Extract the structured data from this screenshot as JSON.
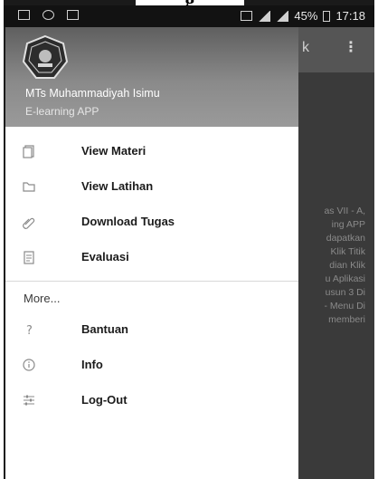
{
  "top_cut_text": "g",
  "status_bar": {
    "battery": "45%",
    "time": "17:18"
  },
  "background_app": {
    "title_fragment": "k",
    "overflow_icon": "more-vertical-icon",
    "text_lines": [
      "as VII - A,",
      "ing APP",
      "dapatkan",
      "Klik Titik",
      "dian Klik",
      "u Aplikasi",
      "usun 3 Di",
      "- Menu Di",
      "memberi"
    ]
  },
  "drawer": {
    "logo_icon": "school-emblem-icon",
    "school_name": "MTs Muhammadiyah Isimu",
    "app_subtitle": "E-learning APP",
    "items": [
      {
        "label": "View Materi",
        "icon": "documents-icon"
      },
      {
        "label": "View Latihan",
        "icon": "folder-icon"
      },
      {
        "label": "Download Tugas",
        "icon": "attachment-icon"
      },
      {
        "label": "Evaluasi",
        "icon": "clipboard-icon"
      }
    ],
    "more_label": "More...",
    "more_items": [
      {
        "label": "Bantuan",
        "icon": "help-icon"
      },
      {
        "label": "Info",
        "icon": "info-icon"
      },
      {
        "label": "Log-Out",
        "icon": "sliders-icon"
      }
    ]
  }
}
